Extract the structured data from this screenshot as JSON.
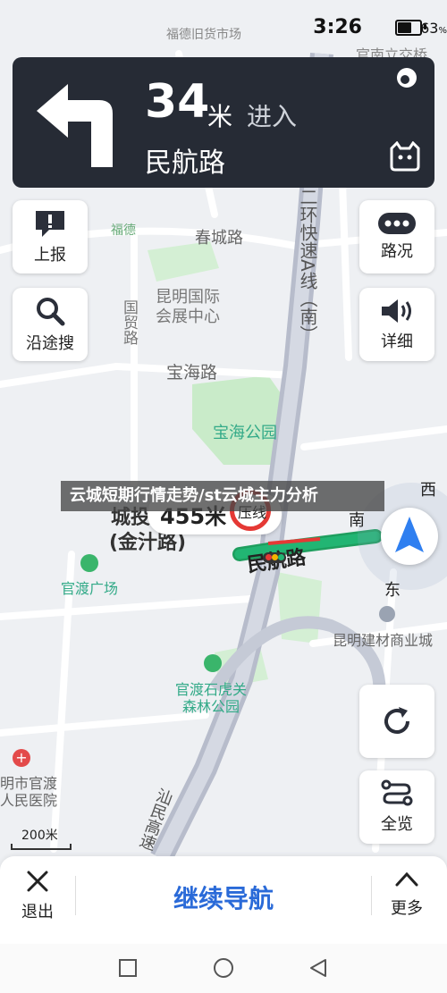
{
  "status": {
    "time": "3:26",
    "battery": "63"
  },
  "nav": {
    "distance": "34",
    "unit": "米",
    "action": "进入",
    "road": "民航路"
  },
  "tiles": {
    "report": "上报",
    "search_along": "沿途搜",
    "traffic": "路况",
    "detail": "详细",
    "overview": "全览"
  },
  "banner": "云城短期行情走势/st云城主力分析",
  "map_labels": {
    "fude_old_market": "福德旧货市场",
    "guannan_li": "官南立交桥",
    "fude": "福德",
    "chuncheng_road": "春城路",
    "ring_highway": "二环快速A线（南）",
    "expo_1": "昆明国际",
    "expo_2": "会展中心",
    "guomao_road": "国贸路",
    "baohai_road": "宝海路",
    "baohai_park": "宝海公园",
    "west": "西",
    "south": "南",
    "east": "东",
    "chengtou_1": "城投",
    "chengtou_2": "(金汁路)",
    "callout_dist": "455米",
    "callout_line": "压线",
    "minhang_road": "民航路",
    "guandu_square": "官渡广场",
    "building_mall": "昆明建材商业城",
    "forest_1": "官渡石虎关",
    "forest_2": "森林公园",
    "hospital_1": "明市官渡",
    "hospital_2": "人民医院",
    "minfei_road": "汕民高速",
    "scale": "200米"
  },
  "bottom": {
    "exit": "退出",
    "continue": "继续导航",
    "more": "更多"
  },
  "colors": {
    "route": "#22b573",
    "nav_bg": "#262b35",
    "accent": "#2a6ad8",
    "puck": "#2f7ff0"
  }
}
